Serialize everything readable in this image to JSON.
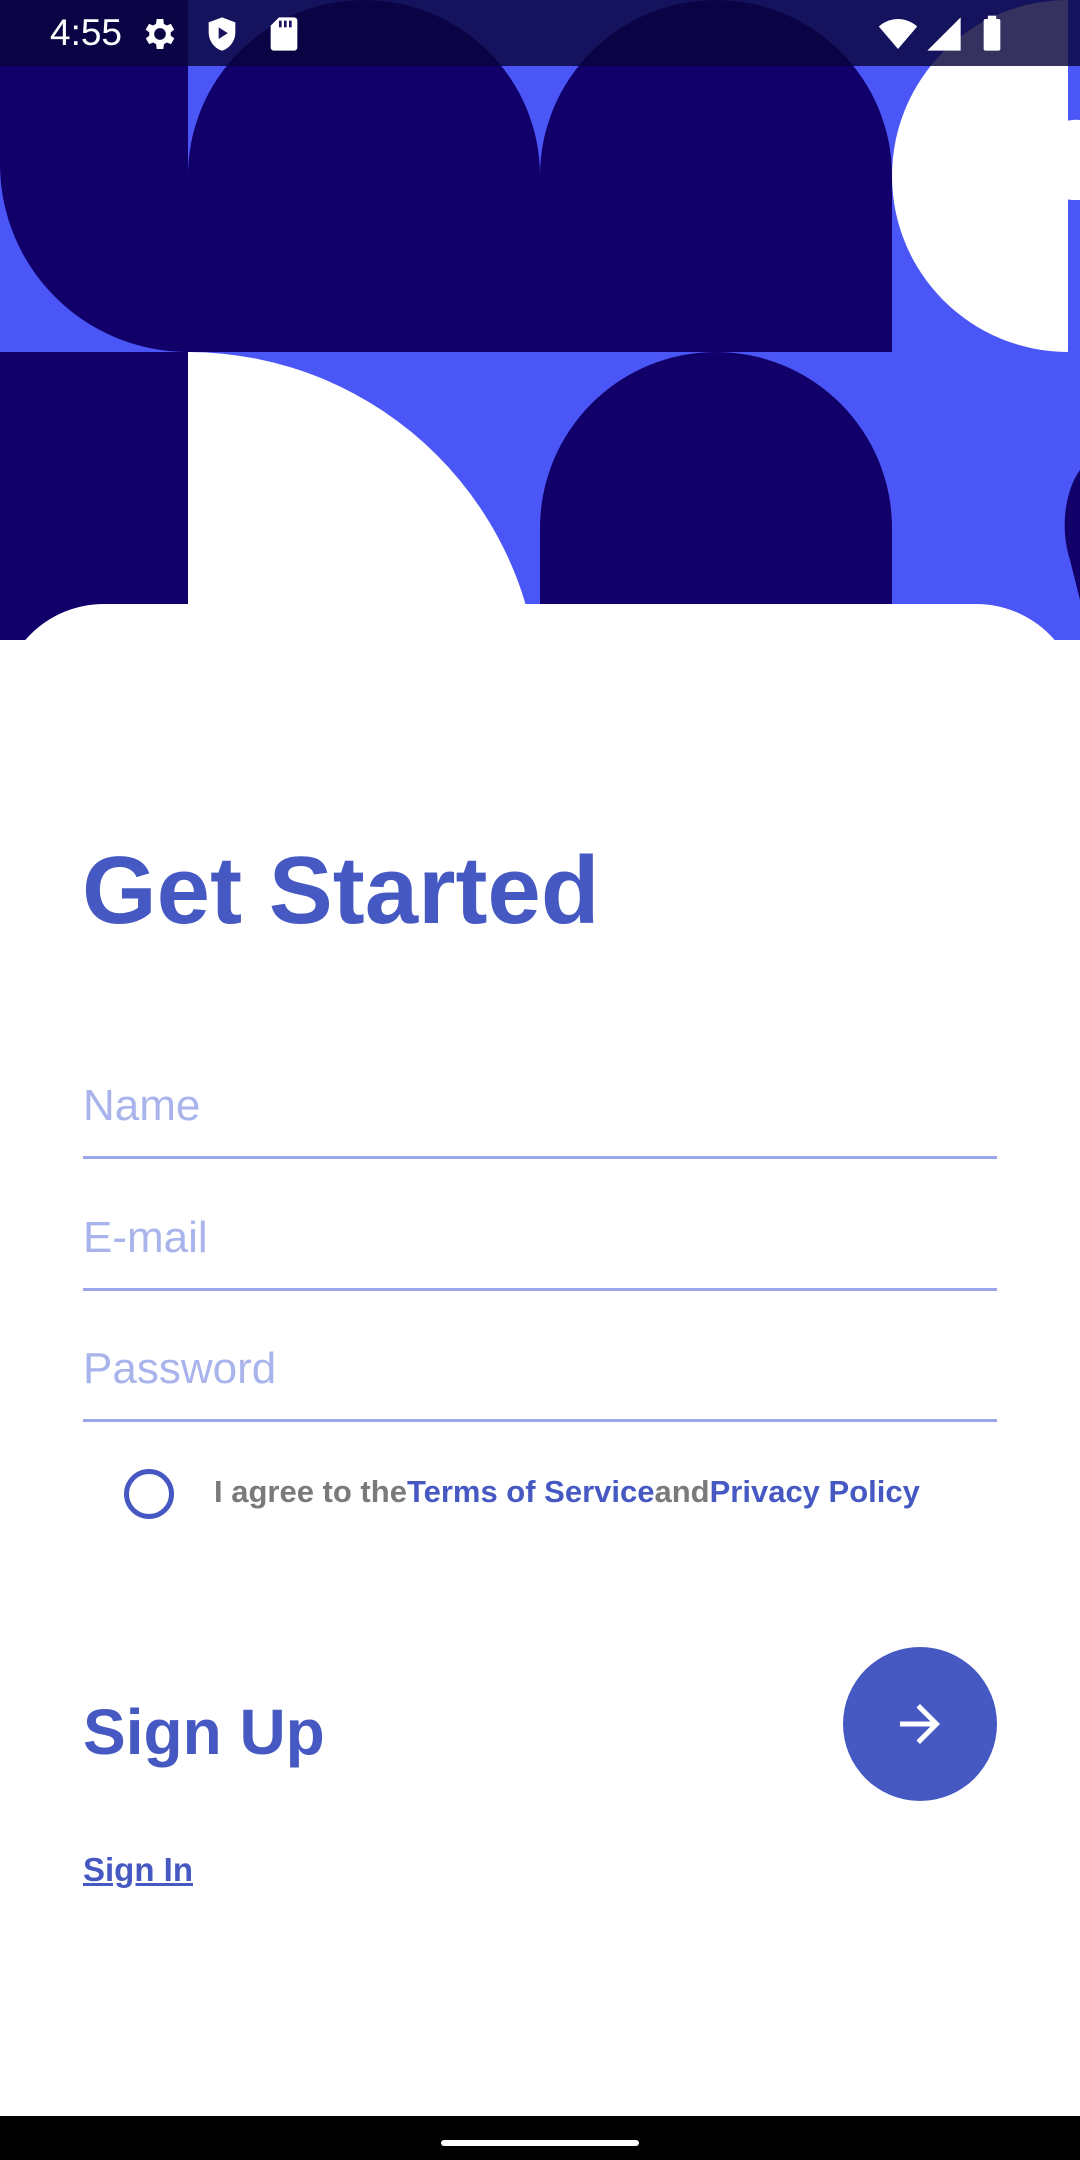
{
  "status_bar": {
    "time": "4:55"
  },
  "header": {
    "pattern_colors": {
      "background": "#4a56f5",
      "dark": "#12006a",
      "light": "#ffffff"
    }
  },
  "main": {
    "title": "Get Started",
    "fields": {
      "name_placeholder": "Name",
      "email_placeholder": "E-mail",
      "password_placeholder": "Password"
    },
    "agreement": {
      "prefix": "I agree to the",
      "terms_link": "Terms of Service",
      "conjunction": "and",
      "privacy_link": "Privacy Policy",
      "checked": false
    },
    "signup_label": "Sign Up",
    "signin_link": "Sign In"
  },
  "theme": {
    "accent": "#4659c2",
    "field_line": "#9aa7ea",
    "placeholder": "#a9b4ec",
    "muted_text": "#7a7a7a"
  },
  "icons": {
    "status": [
      "settings-icon",
      "shield-play-icon",
      "sd-card-icon",
      "wifi-icon",
      "cell-signal-icon",
      "battery-icon"
    ],
    "fab": "arrow-right-icon"
  }
}
